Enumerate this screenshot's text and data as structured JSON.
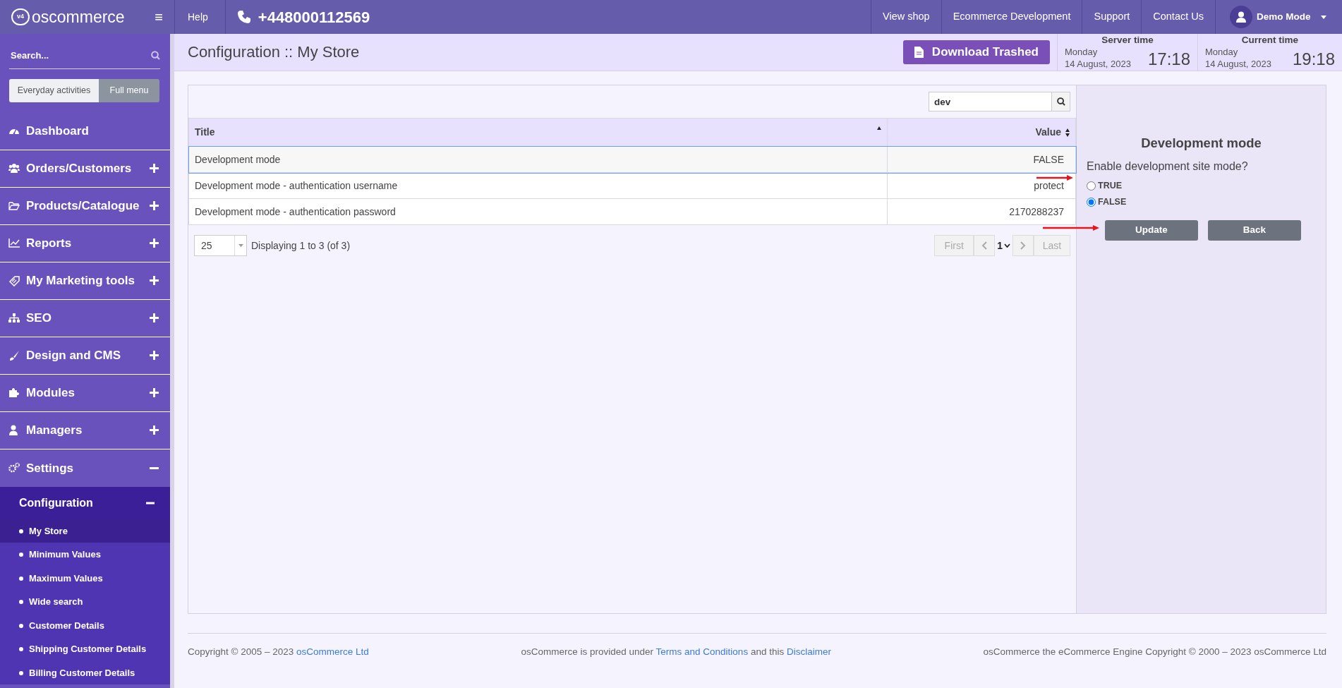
{
  "topbar": {
    "logo_badge": "v4",
    "logo_text": "oscommerce",
    "menu_glyph": "≡",
    "help": "Help",
    "phone": "+448000112569",
    "links": [
      "View shop",
      "Ecommerce Development",
      "Support",
      "Contact Us"
    ],
    "user": "Demo Mode"
  },
  "sidebar": {
    "search": {
      "placeholder": "Search..."
    },
    "modes": [
      {
        "label": "Everyday activities",
        "selected": false
      },
      {
        "label": "Full menu",
        "selected": true
      }
    ],
    "items": [
      {
        "label": "Dashboard"
      },
      {
        "label": "Orders/Customers",
        "expanded": false
      },
      {
        "label": "Products/Catalogue",
        "expanded": false
      },
      {
        "label": "Reports",
        "expanded": false
      },
      {
        "label": "My Marketing tools",
        "expanded": false
      },
      {
        "label": "SEO",
        "expanded": false
      },
      {
        "label": "Design and CMS",
        "expanded": false
      },
      {
        "label": "Modules",
        "expanded": false
      },
      {
        "label": "Managers",
        "expanded": false
      },
      {
        "label": "Settings",
        "expanded": true,
        "children": [
          {
            "label": "Configuration",
            "expanded": true,
            "children": [
              {
                "label": "My Store",
                "selected": true
              },
              {
                "label": "Minimum Values",
                "selected": false
              },
              {
                "label": "Maximum Values",
                "selected": false
              },
              {
                "label": "Wide search",
                "selected": false
              },
              {
                "label": "Customer Details",
                "selected": false
              },
              {
                "label": "Shipping Customer Details",
                "selected": false
              },
              {
                "label": "Billing Customer Details",
                "selected": false
              }
            ]
          }
        ]
      }
    ]
  },
  "header": {
    "title": "Configuration :: My Store",
    "download_button": "Download Trashed",
    "clocks": [
      {
        "label": "Server time",
        "day": "Monday",
        "date": "14 August, 2023",
        "time": "17:18"
      },
      {
        "label": "Current time",
        "day": "Monday",
        "date": "14 August, 2023",
        "time": "19:18"
      }
    ]
  },
  "table": {
    "search": {
      "value": "dev"
    },
    "columns": [
      {
        "label": "Title",
        "sorted": true
      },
      {
        "label": "Value",
        "sorted": false
      }
    ],
    "rows": [
      {
        "title": "Development mode",
        "value": "FALSE",
        "selected": true
      },
      {
        "title": "Development mode - authentication username",
        "value": "protect",
        "selected": false
      },
      {
        "title": "Development mode - authentication password",
        "value": "2170288237",
        "selected": false
      }
    ],
    "per_page": "25",
    "info": "Displaying 1 to 3 (of 3)",
    "pager": [
      {
        "kind": "text",
        "label": "First",
        "disabled": true
      },
      {
        "kind": "prev",
        "disabled": true
      },
      {
        "kind": "page",
        "label": "1"
      },
      {
        "kind": "next",
        "disabled": true
      },
      {
        "kind": "text",
        "label": "Last",
        "disabled": true
      }
    ]
  },
  "edit_panel": {
    "heading": "Development mode",
    "question": "Enable development site mode?",
    "options": [
      {
        "label": "TRUE",
        "selected": false
      },
      {
        "label": "FALSE",
        "selected": true
      }
    ],
    "buttons": [
      "Update",
      "Back"
    ]
  },
  "footer": {
    "left": [
      {
        "kind": "text",
        "text": "Copyright © 2005 – 2023 "
      },
      {
        "kind": "link",
        "text": "osCommerce Ltd"
      }
    ],
    "middle": [
      {
        "kind": "text",
        "text": "osCommerce is provided under "
      },
      {
        "kind": "link",
        "text": "Terms and Conditions"
      },
      {
        "kind": "text",
        "text": " and this "
      },
      {
        "kind": "link",
        "text": "Disclaimer"
      }
    ],
    "right": [
      {
        "kind": "text",
        "text": "osCommerce the eCommerce Engine Copyright © 2000 – 2023 osCommerce Ltd"
      }
    ]
  }
}
